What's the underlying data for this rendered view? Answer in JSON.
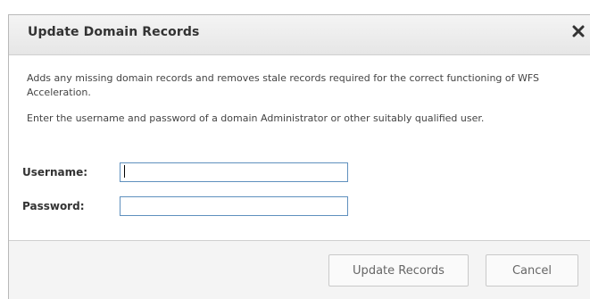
{
  "dialog": {
    "title": "Update Domain Records",
    "close_icon": "close-icon",
    "description": "Adds any missing domain records and removes stale records required for the correct functioning of WFS Acceleration.",
    "instruction": "Enter the username and password of a domain Administrator or other suitably qualified user.",
    "fields": [
      {
        "label": "Username:",
        "value": "",
        "placeholder": ""
      },
      {
        "label": "Password:",
        "value": "",
        "placeholder": ""
      }
    ],
    "buttons": {
      "update": "Update Records",
      "cancel": "Cancel"
    }
  },
  "colors": {
    "titlebar": "#ececec",
    "input_border": "#5f90be",
    "button_text": "#666666"
  }
}
